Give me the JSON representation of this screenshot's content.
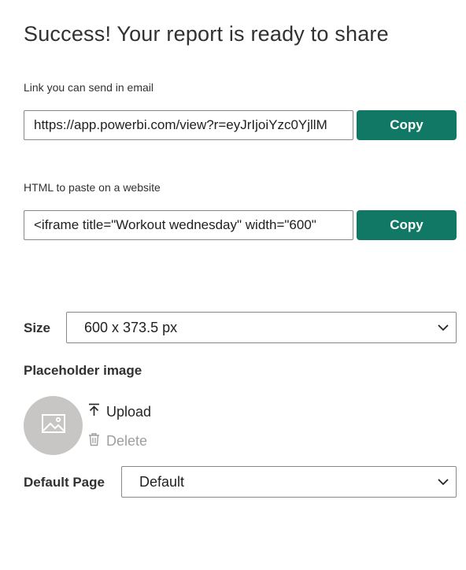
{
  "dialog": {
    "title": "Success! Your report is ready to share"
  },
  "link_section": {
    "label": "Link you can send in email",
    "value": "https://app.powerbi.com/view?r=eyJrIjoiYzc0YjllM",
    "copy_label": "Copy"
  },
  "embed_section": {
    "label": "HTML to paste on a website",
    "value": "<iframe title=\"Workout wednesday\" width=\"600\"",
    "copy_label": "Copy"
  },
  "size": {
    "label": "Size",
    "selected": "600 x 373.5 px"
  },
  "placeholder": {
    "label": "Placeholder image",
    "upload_label": "Upload",
    "delete_label": "Delete"
  },
  "default_page": {
    "label": "Default Page",
    "selected": "Default"
  },
  "colors": {
    "accent": "#117865",
    "border": "#8a8886",
    "disabled_text": "#a19f9d",
    "thumb_bg": "#c8c6c4"
  },
  "icons": {
    "chevron": "chevron-down-icon",
    "image": "image-icon",
    "upload": "upload-icon",
    "delete": "trash-icon"
  }
}
